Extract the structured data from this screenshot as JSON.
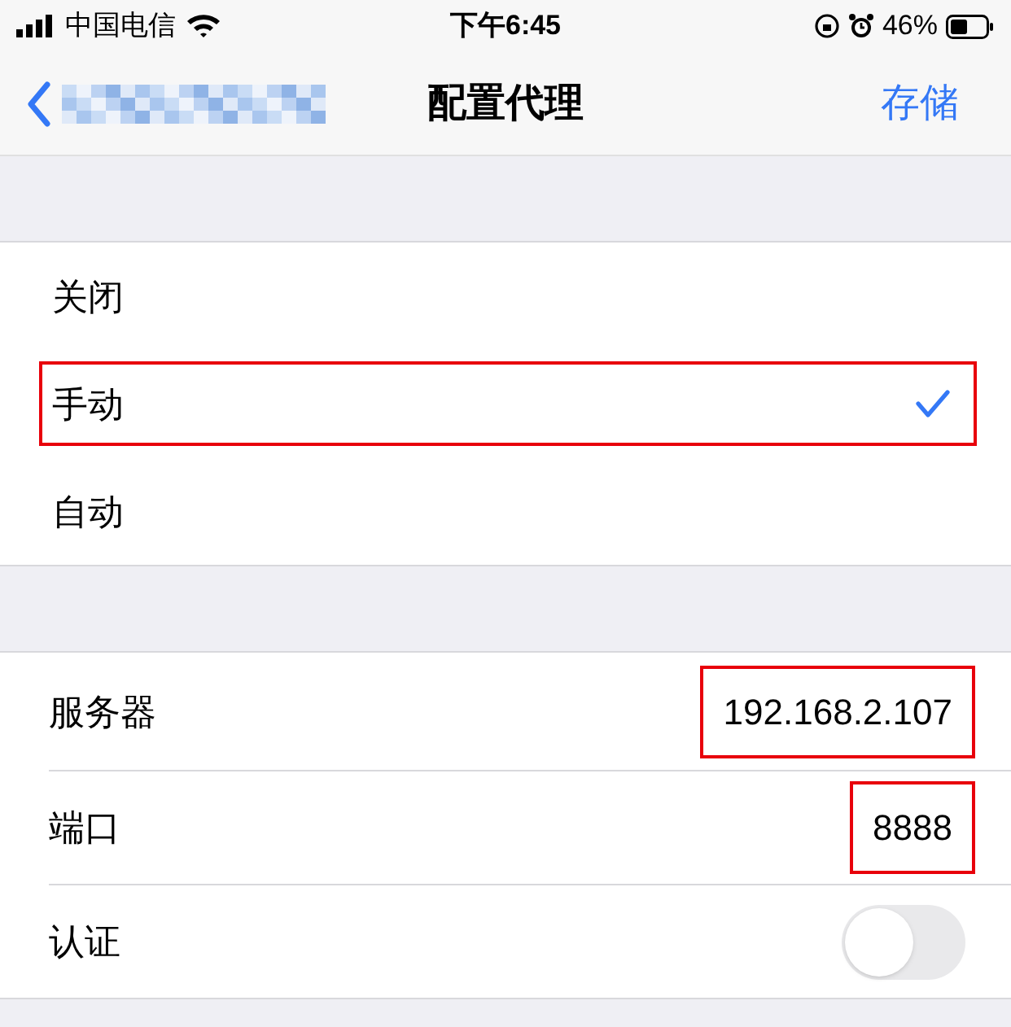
{
  "status_bar": {
    "carrier": "中国电信",
    "time": "下午6:45",
    "battery": "46%"
  },
  "nav": {
    "back_label_redacted": true,
    "title": "配置代理",
    "action": "存储"
  },
  "modes": [
    {
      "label": "关闭",
      "selected": false,
      "highlighted": false
    },
    {
      "label": "手动",
      "selected": true,
      "highlighted": true
    },
    {
      "label": "自动",
      "selected": false,
      "highlighted": false
    }
  ],
  "settings": [
    {
      "kind": "text",
      "label": "服务器",
      "value": "192.168.2.107",
      "highlighted": true
    },
    {
      "kind": "text",
      "label": "端口",
      "value": "8888",
      "highlighted": true
    },
    {
      "kind": "toggle",
      "label": "认证",
      "on": false
    }
  ]
}
